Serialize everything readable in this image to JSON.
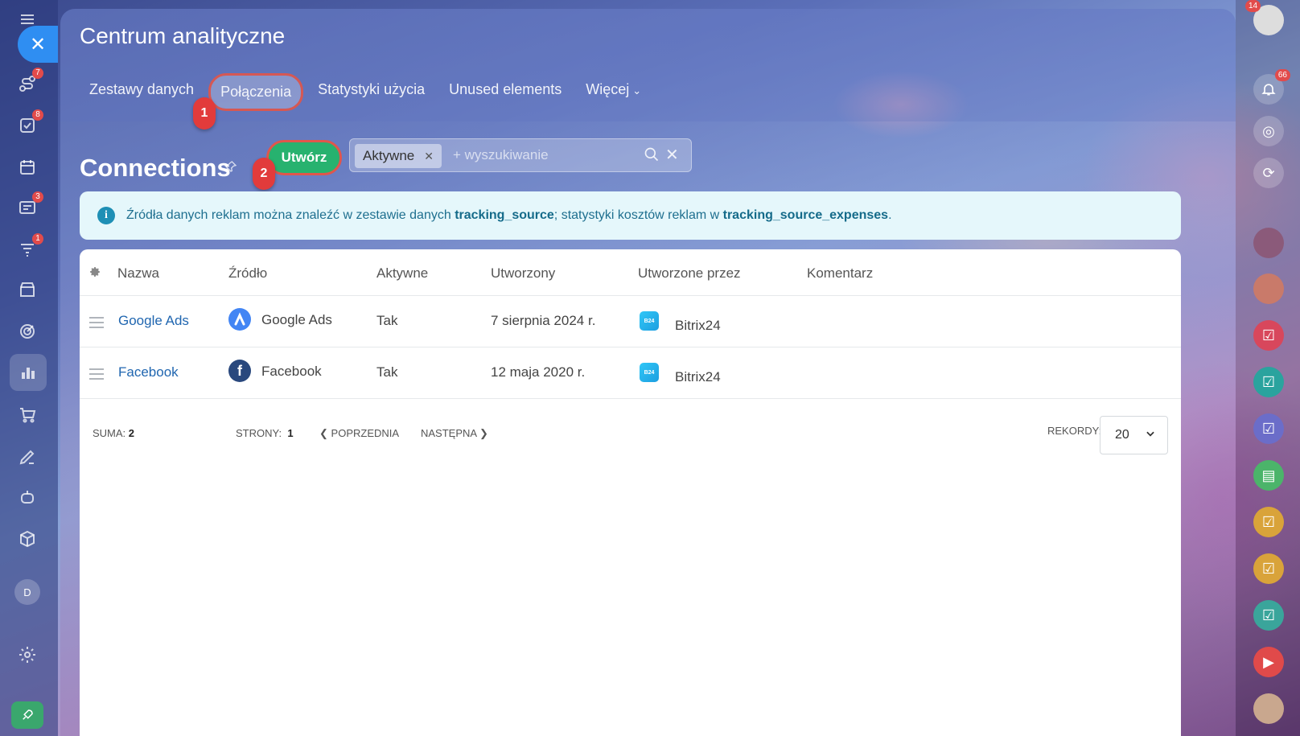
{
  "app": {
    "title": "Centrum analityczne"
  },
  "tabs": [
    {
      "label": "Zestawy danych"
    },
    {
      "label": "Połączenia"
    },
    {
      "label": "Statystyki użycia"
    },
    {
      "label": "Unused elements"
    },
    {
      "label": "Więcej"
    }
  ],
  "annotations": {
    "step1": "1",
    "step2": "2"
  },
  "page": {
    "title": "Connections",
    "create_label": "Utwórz"
  },
  "filter": {
    "tag": "Aktywne",
    "placeholder": "+ wyszukiwanie"
  },
  "info": {
    "text_before": "Źródła danych reklam można znaleźć w zestawie danych ",
    "link1": "tracking_source",
    "text_middle": "; statystyki kosztów reklam w ",
    "link2": "tracking_source_expenses",
    "text_after": "."
  },
  "table": {
    "headers": [
      "Nazwa",
      "Źródło",
      "Aktywne",
      "Utworzony",
      "Utworzone przez",
      "Komentarz"
    ],
    "rows": [
      {
        "name": "Google Ads",
        "source": "Google Ads",
        "active": "Tak",
        "created": "7 sierpnia 2024 r.",
        "author": "Bitrix24",
        "comment": ""
      },
      {
        "name": "Facebook",
        "source": "Facebook",
        "active": "Tak",
        "created": "12 maja 2020 r.",
        "author": "Bitrix24",
        "comment": ""
      }
    ]
  },
  "footer": {
    "total_label": "SUMA:",
    "total": "2",
    "pages_label": "STRONY:",
    "page": "1",
    "prev": "POPRZEDNIA",
    "next": "NASTĘPNA",
    "records_label": "REKORDY:",
    "records": "20"
  },
  "sidebar_badges": {
    "b1": "7",
    "b2": "8",
    "b3": "3",
    "b4": "1",
    "avatar_letter": "D"
  },
  "rightbar_badges": {
    "top": "14",
    "notify": "66"
  }
}
